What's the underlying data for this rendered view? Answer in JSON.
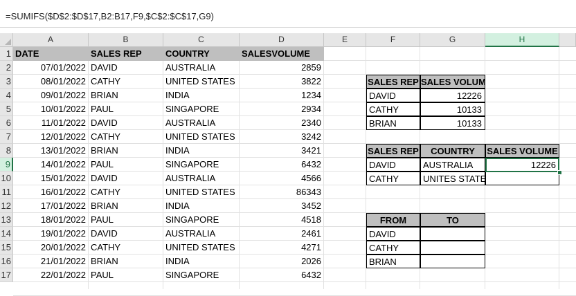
{
  "formula_bar": {
    "text": "=SUMIFS($D$2:$D$17,B2:B17,F9,$C$2:$C$17,G9)"
  },
  "columns": [
    "A",
    "B",
    "C",
    "D",
    "E",
    "F",
    "G",
    "H"
  ],
  "rows": [
    "1",
    "2",
    "3",
    "4",
    "5",
    "6",
    "7",
    "8",
    "9",
    "10",
    "11",
    "12",
    "13",
    "14",
    "15",
    "16",
    "17"
  ],
  "table": {
    "headers": [
      "DATE",
      "SALES REP",
      "COUNTRY",
      "SALESVOLUME"
    ],
    "records": [
      [
        "07/01/2022",
        "DAVID",
        "AUSTRALIA",
        "2859"
      ],
      [
        "08/01/2022",
        "CATHY",
        "UNITED STATES",
        "3822"
      ],
      [
        "09/01/2022",
        "BRIAN",
        "INDIA",
        "1234"
      ],
      [
        "10/01/2022",
        "PAUL",
        "SINGAPORE",
        "2934"
      ],
      [
        "11/01/2022",
        "DAVID",
        "AUSTRALIA",
        "2340"
      ],
      [
        "12/01/2022",
        "CATHY",
        "UNITED STATES",
        "3242"
      ],
      [
        "13/01/2022",
        "BRIAN",
        "INDIA",
        "3421"
      ],
      [
        "14/01/2022",
        "PAUL",
        "SINGAPORE",
        "6432"
      ],
      [
        "15/01/2022",
        "DAVID",
        "AUSTRALIA",
        "4566"
      ],
      [
        "16/01/2022",
        "CATHY",
        "UNITED STATES",
        "86343"
      ],
      [
        "17/01/2022",
        "BRIAN",
        "INDIA",
        "3452"
      ],
      [
        "18/01/2022",
        "PAUL",
        "SINGAPORE",
        "4518"
      ],
      [
        "19/01/2022",
        "DAVID",
        "AUSTRALIA",
        "2461"
      ],
      [
        "20/01/2022",
        "CATHY",
        "UNITED STATES",
        "4271"
      ],
      [
        "21/01/2022",
        "BRIAN",
        "INDIA",
        "2026"
      ],
      [
        "22/01/2022",
        "PAUL",
        "SINGAPORE",
        "6432"
      ]
    ]
  },
  "summary1": {
    "headers": [
      "SALES REP",
      "SALES VOLUME"
    ],
    "rows": [
      [
        "DAVID",
        "12226"
      ],
      [
        "CATHY",
        "10133"
      ],
      [
        "BRIAN",
        "10133"
      ]
    ]
  },
  "summary2": {
    "headers": [
      "SALES REP",
      "COUNTRY",
      "SALES VOLUME"
    ],
    "rows": [
      [
        "DAVID",
        "AUSTRALIA",
        "12226"
      ],
      [
        "CATHY",
        "UNITES STATES",
        ""
      ]
    ]
  },
  "summary3": {
    "headers": [
      "FROM",
      "TO"
    ],
    "rows": [
      [
        "DAVID",
        ""
      ],
      [
        "CATHY",
        ""
      ],
      [
        "BRIAN",
        ""
      ]
    ]
  },
  "selection": {
    "active_cell": "H9"
  }
}
